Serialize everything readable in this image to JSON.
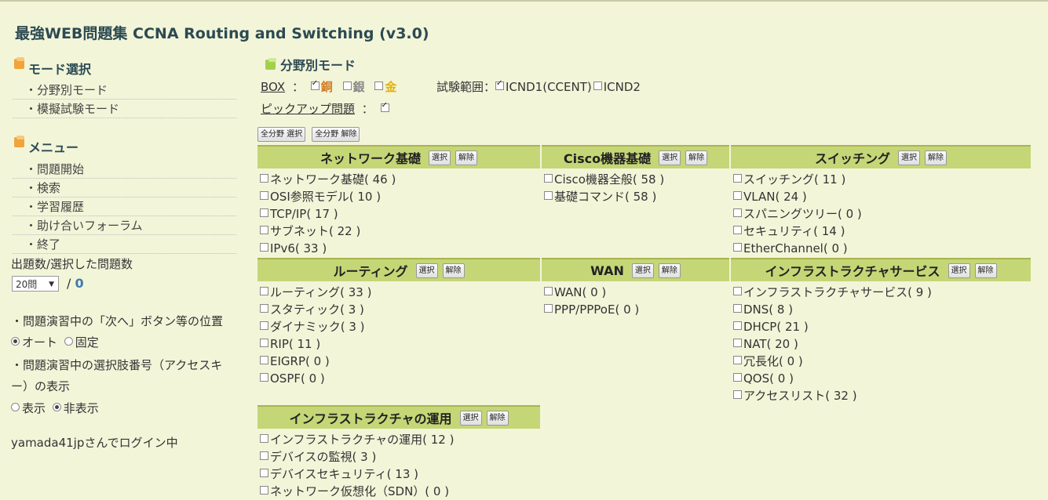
{
  "title": "最強WEB問題集 CCNA Routing and Switching (v3.0)",
  "sidebar": {
    "mode_heading": "モード選択",
    "mode_items": [
      "・分野別モード",
      "・模擬試験モード"
    ],
    "menu_heading": "メニュー",
    "menu_items": [
      "・問題開始",
      "・検索",
      "・学習履歴",
      "・助け合いフォーラム",
      "・終了"
    ],
    "count_label": "出題数/選択した問題数",
    "count_select": "20問",
    "count_sep": "/",
    "count_value": "0",
    "position_label": "・問題演習中の「次へ」ボタン等の位置",
    "position_options": [
      "オート",
      "固定"
    ],
    "accesskey_label_1": "・問題演習中の選択肢番号（アクセスキ",
    "accesskey_label_2": "ー）の表示",
    "accesskey_options": [
      "表示",
      "非表示"
    ],
    "login_status": "yamada41jpさんでログイン中"
  },
  "main": {
    "heading": "分野別モード",
    "box_label": "BOX",
    "box_colon": "：",
    "box_options": [
      "銅",
      "銀",
      "金"
    ],
    "scope_label": "試験範囲：",
    "scope_options": [
      "ICND1(CCENT)",
      "ICND2"
    ],
    "pickup_label": "ピックアップ問題",
    "pickup_colon": "：",
    "select_all": "全分野 選択",
    "clear_all": "全分野 解除",
    "select_btn": "選択",
    "clear_btn": "解除",
    "categories": [
      {
        "name": "ネットワーク基礎",
        "items": [
          "ネットワーク基礎( 46 )",
          "OSI参照モデル( 10 )",
          "TCP/IP( 17 )",
          "サブネット( 22 )",
          "IPv6( 33 )"
        ]
      },
      {
        "name": "Cisco機器基礎",
        "items": [
          "Cisco機器全般( 58 )",
          "基礎コマンド( 58 )"
        ]
      },
      {
        "name": "スイッチング",
        "items": [
          "スイッチング( 11 )",
          "VLAN( 24 )",
          "スパニングツリー( 0 )",
          "セキュリティ( 14 )",
          "EtherChannel( 0 )"
        ]
      },
      {
        "name": "ルーティング",
        "items": [
          "ルーティング( 33 )",
          "スタティック( 3 )",
          "ダイナミック( 3 )",
          "RIP( 11 )",
          "EIGRP( 0 )",
          "OSPF( 0 )"
        ]
      },
      {
        "name": "WAN",
        "items": [
          "WAN( 0 )",
          "PPP/PPPoE( 0 )"
        ]
      },
      {
        "name": "インフラストラクチャサービス",
        "items": [
          "インフラストラクチャサービス( 9 )",
          "DNS( 8 )",
          "DHCP( 21 )",
          "NAT( 20 )",
          "冗長化( 0 )",
          "QOS( 0 )",
          "アクセスリスト( 32 )"
        ]
      },
      {
        "name": "インフラストラクチャの運用",
        "items": [
          "インフラストラクチャの運用( 12 )",
          "デバイスの監視( 3 )",
          "デバイスセキュリティ( 13 )",
          "ネットワーク仮想化（SDN）( 0 )"
        ]
      }
    ]
  }
}
